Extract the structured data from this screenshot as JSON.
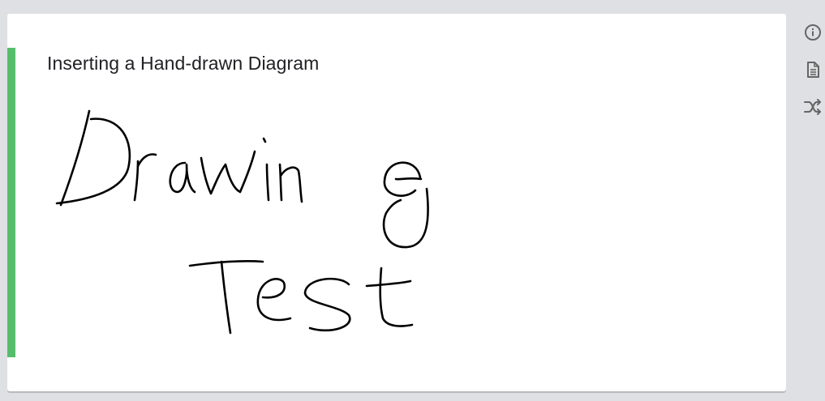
{
  "cell": {
    "title": "Inserting a Hand-drawn Diagram",
    "accent_color": "#56bd6c",
    "drawing": {
      "handwritten_text": [
        "Drawing",
        "Test"
      ]
    }
  },
  "toolbar": {
    "icons": [
      "info-icon",
      "document-icon",
      "shuffle-icon"
    ]
  }
}
